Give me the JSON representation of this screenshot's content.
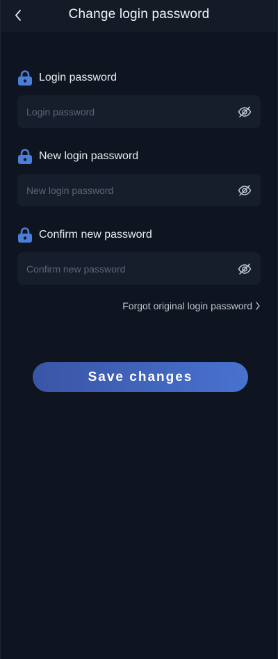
{
  "header": {
    "title": "Change login password",
    "back_icon": "chevron-left-icon"
  },
  "fields": [
    {
      "label": "Login password",
      "placeholder": "Login password",
      "value": "",
      "icon": "lock-icon",
      "toggle_icon": "eye-off-icon"
    },
    {
      "label": "New login password",
      "placeholder": "New login password",
      "value": "",
      "icon": "lock-icon",
      "toggle_icon": "eye-off-icon"
    },
    {
      "label": "Confirm new password",
      "placeholder": "Confirm new password",
      "value": "",
      "icon": "lock-icon",
      "toggle_icon": "eye-off-icon"
    }
  ],
  "forgot_link": {
    "label": "Forgot original login password",
    "icon": "chevron-right-icon"
  },
  "save_button": {
    "label": "Save changes"
  },
  "colors": {
    "background": "#0f1520",
    "header": "#141b27",
    "input": "#161e2b",
    "accent": "#4a7ed8",
    "button_start": "#3a55a6",
    "button_end": "#4872cf"
  }
}
